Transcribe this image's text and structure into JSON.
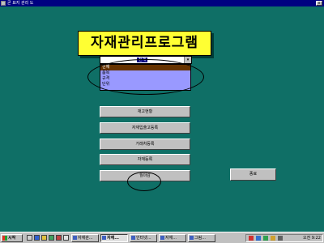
{
  "window": {
    "title": "곧 표지 관리 도",
    "close_label": "x"
  },
  "banner": {
    "title": "자재관리프로그램"
  },
  "combo": {
    "value": "전체",
    "arrow": "▾"
  },
  "dropdown": {
    "options": [
      "전체",
      "품목",
      "규격",
      "단위"
    ]
  },
  "buttons": {
    "b1": "재고현황",
    "b2": "자재입출고등록",
    "b3": "거래처등록",
    "b4": "자재등록",
    "b5": "월마감",
    "quit": "종료"
  },
  "taskbar": {
    "start": "시작",
    "tasks": [
      "자재관...",
      "자재...",
      "인터넷...",
      "자재...",
      "그림..."
    ],
    "clock": "오전 9:22"
  },
  "colors": {
    "form_bg": "#0f6f66",
    "banner_bg": "#ffff33",
    "dropdown_bg": "#9999ff",
    "titlebar": "#000080"
  }
}
